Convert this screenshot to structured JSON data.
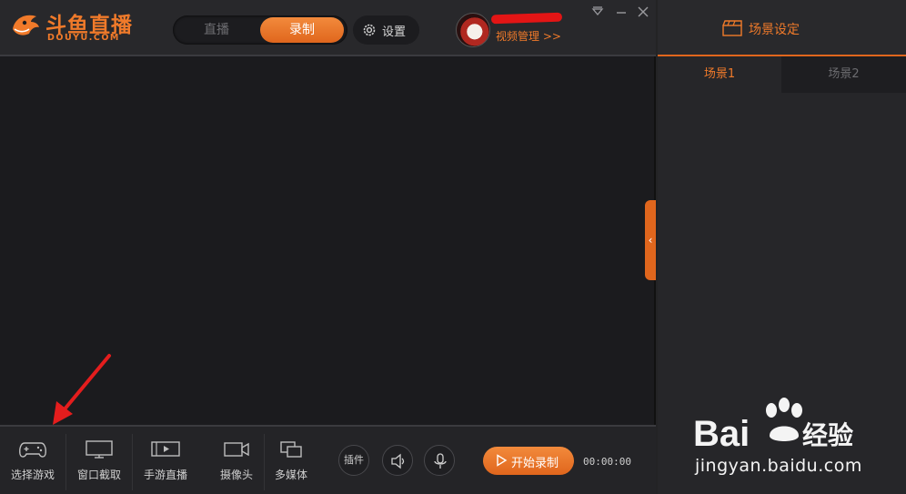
{
  "brand": {
    "name": "斗鱼直播",
    "domain": "DOUYU.COM",
    "accent": "#f07a2a"
  },
  "header": {
    "mode_tabs": [
      {
        "label": "直播",
        "active": false
      },
      {
        "label": "录制",
        "active": true
      }
    ],
    "settings_label": "设置",
    "video_manage_label": "视频管理 >>",
    "window_controls": [
      "dropdown-icon",
      "minimize-icon",
      "close-icon"
    ]
  },
  "toolbar": {
    "tools": [
      {
        "label": "选择游戏",
        "icon": "gamepad-icon"
      },
      {
        "label": "窗口截取",
        "icon": "monitor-icon"
      },
      {
        "label": "手游直播",
        "icon": "phone-play-icon"
      },
      {
        "label": "摄像头",
        "icon": "camera-icon"
      },
      {
        "label": "多媒体",
        "icon": "media-icon"
      }
    ],
    "plugin_label": "插件",
    "speaker_icon": "speaker-icon",
    "mic_icon": "microphone-icon",
    "start_record_label": "开始录制",
    "timer": "00:00:00"
  },
  "panel": {
    "title": "场景设定",
    "scenes": [
      {
        "label": "场景1",
        "active": true
      },
      {
        "label": "场景2",
        "active": false
      }
    ]
  },
  "watermark": {
    "brand_left": "Bai",
    "brand_right": "经验",
    "url": "jingyan.baidu.com"
  }
}
